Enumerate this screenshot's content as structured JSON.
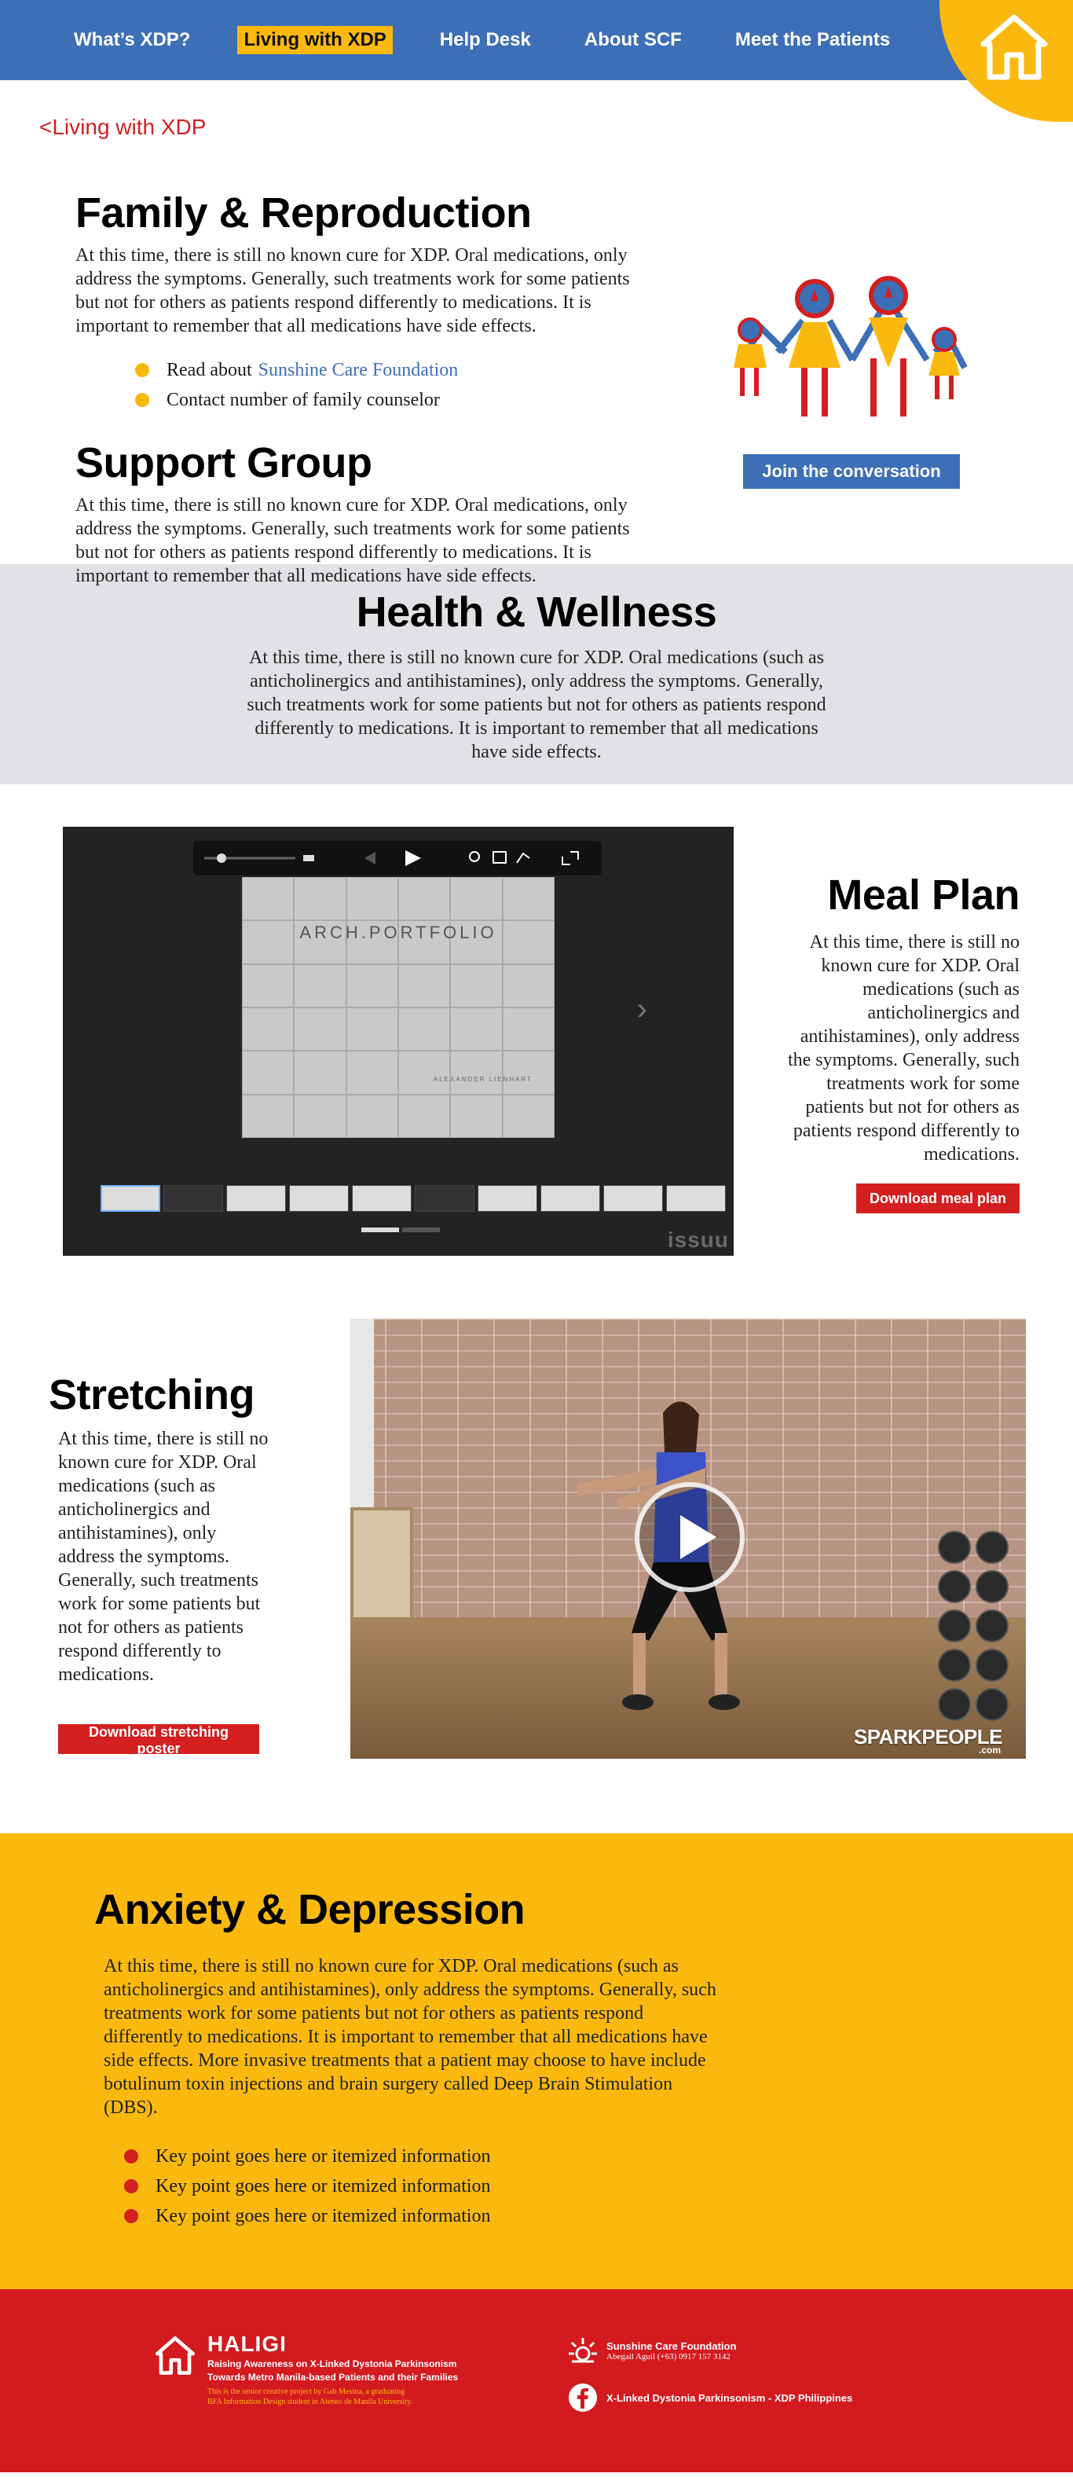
{
  "nav": {
    "items": [
      {
        "label": "What’s XDP?",
        "active": false
      },
      {
        "label": "Living with XDP",
        "active": true
      },
      {
        "label": "Help Desk",
        "active": false
      },
      {
        "label": "About SCF",
        "active": false
      },
      {
        "label": "Meet the Patients",
        "active": false
      }
    ],
    "home_icon": "house-icon"
  },
  "breadcrumb": "<Living with XDP",
  "family": {
    "title": "Family & Reproduction",
    "body": "At this time, there is still no known cure for XDP. Oral medications, only address the symptoms. Generally, such treatments work for some patients but not for others as patients respond differently to medications. It is important to remember that all medications have side effects.",
    "bullets": [
      {
        "text": "Read about",
        "link": "Sunshine Care Foundation"
      },
      {
        "text": "Contact number of family counselor",
        "link": ""
      }
    ],
    "join_button": "Join the conversation"
  },
  "support": {
    "title": "Support Group",
    "body": "At this time, there is still no known cure for XDP. Oral medications, only address the symptoms. Generally, such treatments work for some patients but not for others as patients respond differently to medications. It is important to remember that all medications have side effects."
  },
  "health": {
    "title": "Health & Wellness",
    "body": "At this time, there is still no known cure for XDP. Oral medications (such as anticholinergics and antihistamines), only address the symptoms. Generally, such treatments work for some patients but not for others as patients respond differently to medications. It is important to remember that all medications have side effects."
  },
  "meal": {
    "title": "Meal Plan",
    "body": "At this time, there is still no known cure for XDP. Oral medications (such as anticholinergics and antihistamines), only address the symptoms. Generally, such treatments work for some patients but not for others as patients respond differently to medications.",
    "button": "Download meal plan",
    "viewer": {
      "cover_title": "ARCH.PORTFOLIO",
      "cover_author": "ALEXANDER LIENHART",
      "brand": "issuu"
    }
  },
  "stretching": {
    "title": "Stretching",
    "body": "At this time, there is still no known cure for XDP. Oral medications (such as anticholinergics and antihistamines), only address the symptoms. Generally, such treatments work for some patients but not for others as patients respond differently to medications.",
    "button": "Download stretching poster",
    "video_brand": "SPARKPEOPLE",
    "video_brand_suffix": ".com"
  },
  "anxiety": {
    "title": "Anxiety & Depression",
    "body": "At this time, there is still no known cure for XDP. Oral medications (such as anticholinergics and antihistamines), only address the symptoms. Generally, such treatments work for some patients but not for others as patients respond differently to medications. It is important to remember that all medications have side effects. More invasive treatments that a patient may choose to have include botulinum toxin injections and brain surgery called Deep Brain Stimulation (DBS).",
    "bullets": [
      "Key point goes here or itemized information",
      "Key point goes here or itemized information",
      "Key point goes here or itemized information"
    ]
  },
  "footer": {
    "brand": "HALIGI",
    "tagline1": "Raising Awareness on X-Linked Dystonia Parkinsonism",
    "tagline2": "Towards Metro Manila-based Patients and their Families",
    "credit1": "This is the senior creative project by Gab Mesina, a graduating",
    "credit2": "BFA Information Design student in Ateneo de Manila University.",
    "scf_name": "Sunshine Care Foundation",
    "scf_contact": "Abegail Aguil (+63) 0917 157 3142",
    "facebook": "X-Linked Dystonia Parkinsonism - XDP Philippines"
  },
  "colors": {
    "blue": "#3d6fb6",
    "yellow": "#fbb90f",
    "red": "#d31f1f",
    "gray": "#e2e2e6"
  }
}
